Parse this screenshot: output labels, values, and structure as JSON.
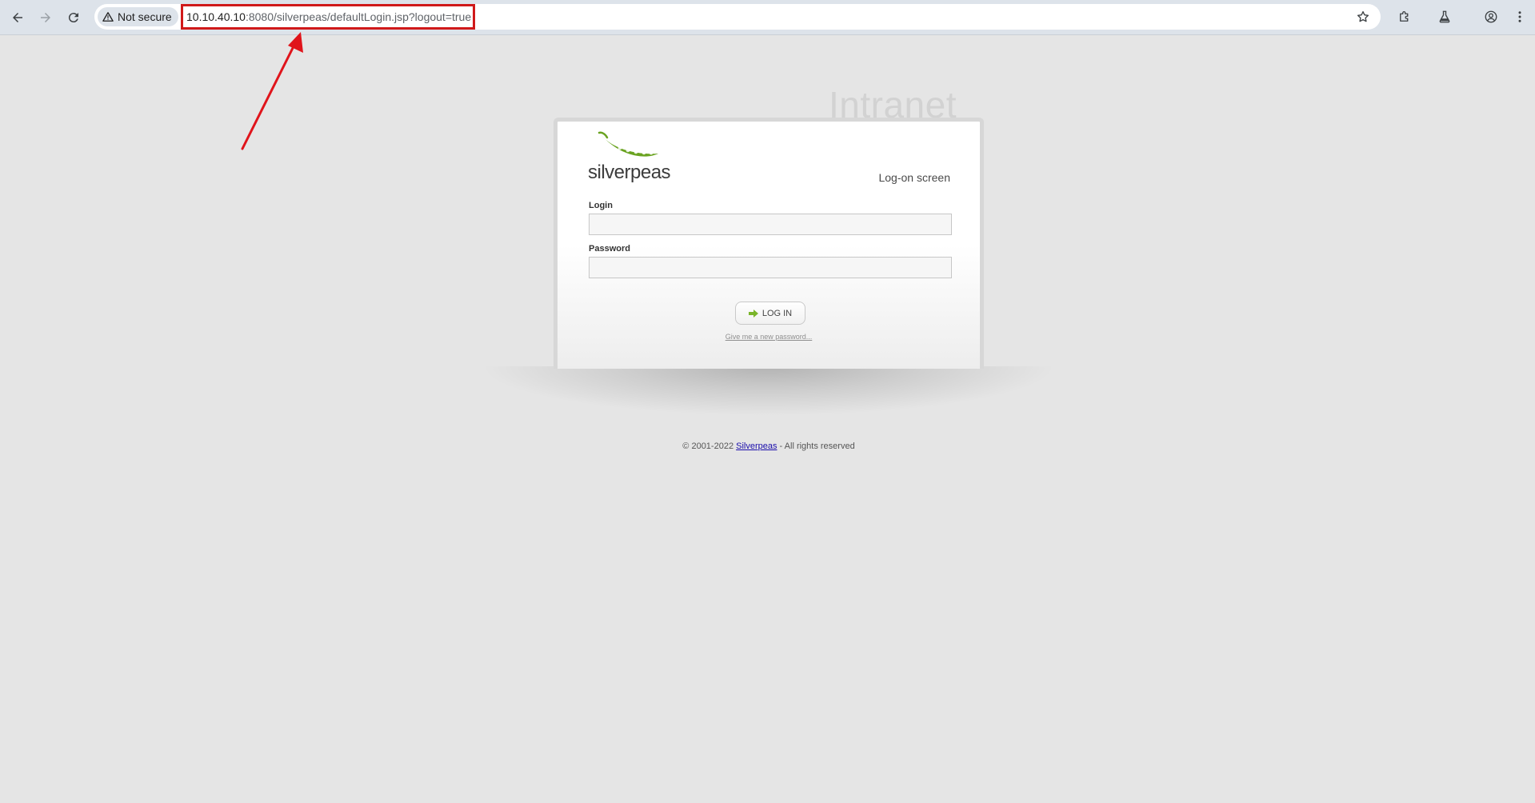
{
  "browser": {
    "security_label": "Not secure",
    "url_host": "10.10.40.10",
    "url_rest": ":8080/silverpeas/defaultLogin.jsp?logout=true",
    "icons": [
      "back-icon",
      "forward-icon",
      "reload-icon",
      "warning-icon",
      "star-icon",
      "extensions-icon",
      "labs-icon",
      "profile-icon",
      "menu-icon"
    ]
  },
  "annotation": {
    "color": "#e0141b"
  },
  "page": {
    "watermark": "Intranet",
    "logo_text": "silverpeas",
    "screen_title": "Log-on screen",
    "login_label": "Login",
    "login_value": "",
    "password_label": "Password",
    "password_value": "",
    "login_button": "LOG IN",
    "forgot_link": "Give me a new password...",
    "footer_prefix": "© 2001-2022",
    "footer_link": "Silverpeas",
    "footer_suffix": "- All rights reserved",
    "brand_green": "#7ab52a"
  }
}
